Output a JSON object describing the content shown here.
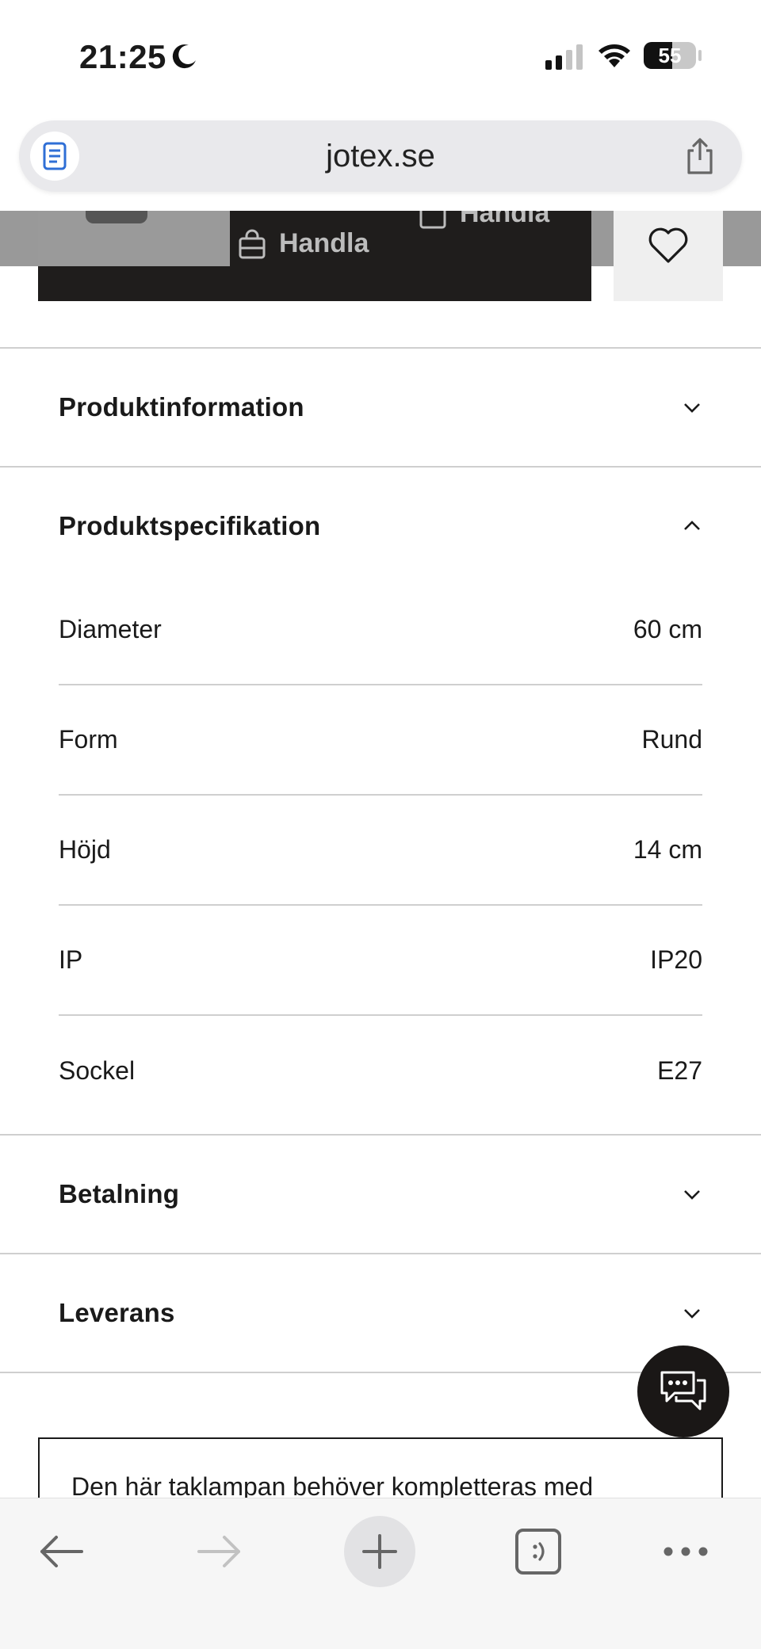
{
  "status_bar": {
    "time": "21:25",
    "battery": "55",
    "battery_level": 0.55
  },
  "browser": {
    "url": "jotex.se"
  },
  "sticky_bar": {
    "buy_label": "Handla"
  },
  "accordion": {
    "sections": [
      {
        "title": "Produktinformation",
        "expanded": false
      },
      {
        "title": "Produktspecifikation",
        "expanded": true
      },
      {
        "title": "Betalning",
        "expanded": false
      },
      {
        "title": "Leverans",
        "expanded": false
      }
    ],
    "specs": [
      {
        "label": "Diameter",
        "value": "60 cm"
      },
      {
        "label": "Form",
        "value": "Rund"
      },
      {
        "label": "Höjd",
        "value": "14 cm"
      },
      {
        "label": "IP",
        "value": "IP20"
      },
      {
        "label": "Sockel",
        "value": "E27"
      }
    ]
  },
  "notice": {
    "text": "Den här taklampan behöver kompletteras med"
  },
  "icons": {
    "reader": "reader-icon",
    "share": "share-icon",
    "heart": "heart-icon",
    "chat": "chat-icon",
    "back": "back-arrow-icon",
    "forward": "forward-arrow-icon",
    "new_tab": "plus-icon",
    "tabs": "tabs-icon",
    "more": "more-icon"
  },
  "colors": {
    "text": "#1a1a1a",
    "divider": "#cfcfcf",
    "sticky_black": "#1f1d1c",
    "url_bar_bg": "#e9e9ec",
    "reader_icon": "#2f6fd6"
  }
}
